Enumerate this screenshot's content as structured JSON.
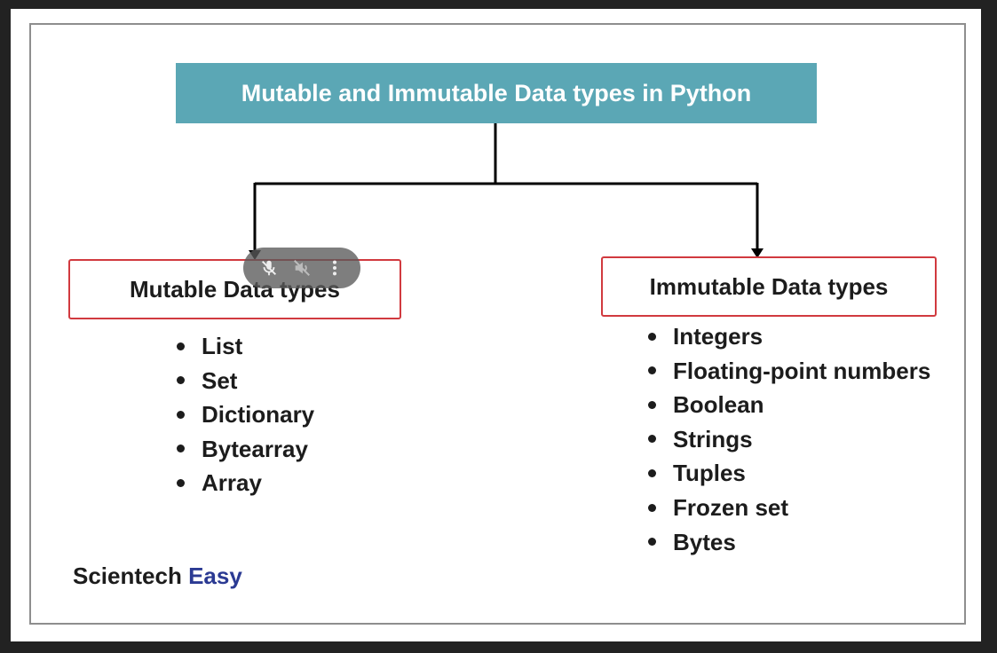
{
  "diagram": {
    "title": "Mutable and Immutable Data types in Python",
    "mutable": {
      "label": "Mutable Data types",
      "items": [
        "List",
        "Set",
        "Dictionary",
        "Bytearray",
        "Array"
      ]
    },
    "immutable": {
      "label": "Immutable Data types",
      "items": [
        "Integers",
        "Floating-point numbers",
        "Boolean",
        "Strings",
        "Tuples",
        "Frozen set",
        "Bytes"
      ]
    }
  },
  "brand": {
    "part1": "Scientech",
    "part2": "Easy"
  },
  "colors": {
    "title_bg": "#5ba7b5",
    "box_border": "#d13a3f",
    "brand_accent": "#2b3a93"
  },
  "overlay_icons": [
    "mic-off-icon",
    "volume-off-icon",
    "more-vert-icon"
  ]
}
